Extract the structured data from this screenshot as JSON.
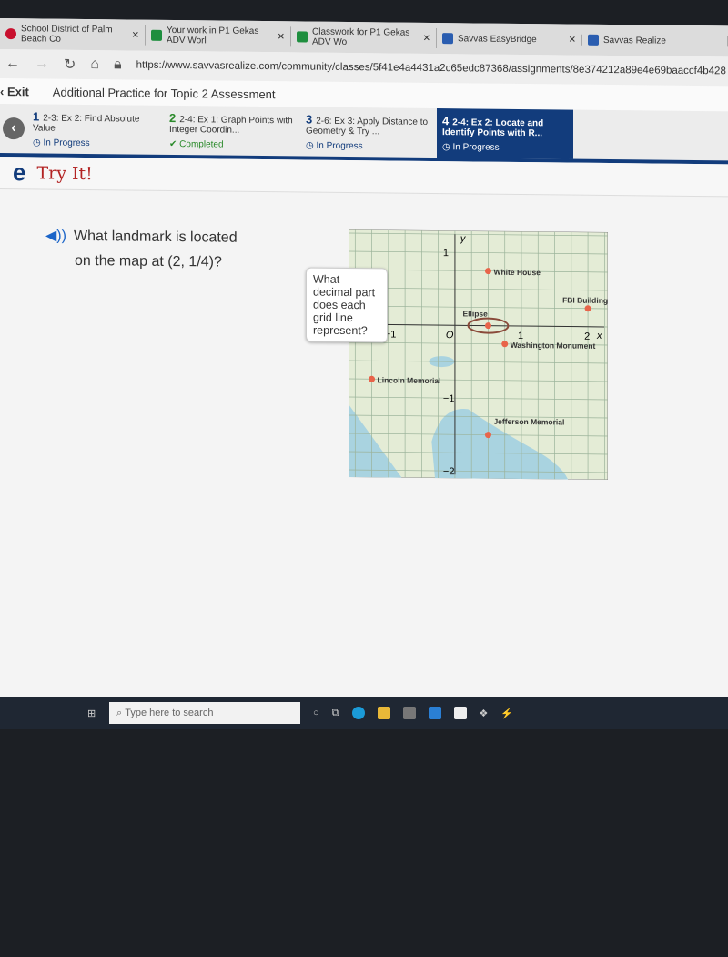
{
  "browser": {
    "tabs": [
      {
        "title": "School District of Palm Beach Co",
        "color": "#c8102e"
      },
      {
        "title": "Your work in P1 Gekas ADV Worl",
        "color": "#1e8e3e"
      },
      {
        "title": "Classwork for P1 Gekas ADV Wo",
        "color": "#1e8e3e"
      },
      {
        "title": "Savvas EasyBridge",
        "color": "#2a5db0"
      },
      {
        "title": "Savvas Realize",
        "color": "#2a5db0"
      }
    ],
    "url": "https://www.savvasrealize.com/community/classes/5f41e4a4431a2c65edc87368/assignments/8e374212a89e4e69baaccf4b428"
  },
  "header": {
    "exit": "Exit",
    "title": "Additional Practice for Topic 2 Assessment"
  },
  "steps": [
    {
      "num": "1",
      "title": "2-3: Ex 2: Find Absolute Value",
      "status": "In Progress"
    },
    {
      "num": "2",
      "title": "2-4: Ex 1: Graph Points with Integer Coordin...",
      "status": "Completed"
    },
    {
      "num": "3",
      "title": "2-6: Ex 3: Apply Distance to Geometry & Try ...",
      "status": "In Progress"
    },
    {
      "num": "4",
      "title": "2-4: Ex 2: Locate and Identify Points with R...",
      "status": "In Progress"
    }
  ],
  "tryit": {
    "logo": "e",
    "title": "Try It!"
  },
  "question": {
    "line1": "What landmark is located",
    "line2": "on the map at",
    "coord": "(2, 1/4)?"
  },
  "hint": "What decimal part does each grid line represent?",
  "chart_data": {
    "type": "scatter",
    "xlabel": "x",
    "ylabel": "y",
    "origin_label": "O",
    "grid_step": 0.25,
    "xlim": [
      -1.6,
      2.3
    ],
    "ylim": [
      -2.1,
      1.3
    ],
    "xticks": [
      {
        "v": -1,
        "label": "−1"
      },
      {
        "v": 1,
        "label": "1"
      },
      {
        "v": 2,
        "label": "2"
      }
    ],
    "yticks": [
      {
        "v": 1,
        "label": "1"
      },
      {
        "v": -1,
        "label": "−1"
      },
      {
        "v": -2,
        "label": "−2"
      }
    ],
    "points": [
      {
        "name": "White House",
        "x": 0.5,
        "y": 0.75
      },
      {
        "name": "Ellipse",
        "x": 0.5,
        "y": 0
      },
      {
        "name": "FBI Building",
        "x": 2,
        "y": 0.25
      },
      {
        "name": "Washington Monument",
        "x": 0.75,
        "y": -0.25
      },
      {
        "name": "Lincoln Memorial",
        "x": -1.25,
        "y": -0.75
      },
      {
        "name": "Jefferson Memorial",
        "x": 0.5,
        "y": -1.5
      }
    ],
    "colors": {
      "grid": "#9bb39a",
      "land": "#e4ecd6",
      "water": "#a9d3e0",
      "point": "#e8644a"
    }
  },
  "taskbar": {
    "search_placeholder": "Type here to search"
  }
}
